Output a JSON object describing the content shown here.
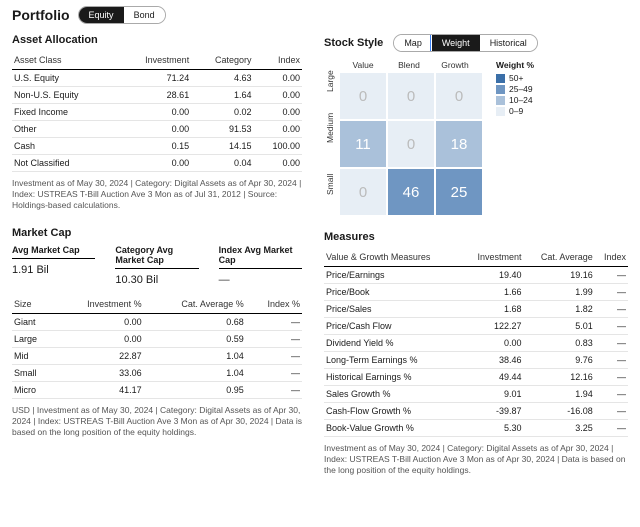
{
  "header": {
    "title": "Portfolio",
    "tabs": [
      "Equity",
      "Bond"
    ]
  },
  "asset_alloc": {
    "title": "Asset Allocation",
    "cols": [
      "Asset Class",
      "Investment",
      "Category",
      "Index"
    ],
    "rows": [
      {
        "c0": "U.S. Equity",
        "c1": "71.24",
        "c2": "4.63",
        "c3": "0.00"
      },
      {
        "c0": "Non-U.S. Equity",
        "c1": "28.61",
        "c2": "1.64",
        "c3": "0.00"
      },
      {
        "c0": "Fixed Income",
        "c1": "0.00",
        "c2": "0.02",
        "c3": "0.00"
      },
      {
        "c0": "Other",
        "c1": "0.00",
        "c2": "91.53",
        "c3": "0.00"
      },
      {
        "c0": "Cash",
        "c1": "0.15",
        "c2": "14.15",
        "c3": "100.00"
      },
      {
        "c0": "Not Classified",
        "c1": "0.00",
        "c2": "0.04",
        "c3": "0.00"
      }
    ],
    "foot": "Investment as of May 30, 2024 | Category: Digital Assets as of Apr 30, 2024 | Index: USTREAS T-Bill Auction Ave 3 Mon as of Jul 31, 2012 | Source: Holdings-based calculations."
  },
  "market_cap": {
    "title": "Market Cap",
    "avg_lbl": "Avg Market Cap",
    "avg_val": "1.91 Bil",
    "cat_lbl": "Category Avg Market Cap",
    "cat_val": "10.30 Bil",
    "idx_lbl": "Index Avg Market Cap",
    "idx_val": "—",
    "cols": [
      "Size",
      "Investment %",
      "Cat. Average %",
      "Index %"
    ],
    "rows": [
      {
        "c0": "Giant",
        "c1": "0.00",
        "c2": "0.68",
        "c3": "—"
      },
      {
        "c0": "Large",
        "c1": "0.00",
        "c2": "0.59",
        "c3": "—"
      },
      {
        "c0": "Mid",
        "c1": "22.87",
        "c2": "1.04",
        "c3": "—"
      },
      {
        "c0": "Small",
        "c1": "33.06",
        "c2": "1.04",
        "c3": "—"
      },
      {
        "c0": "Micro",
        "c1": "41.17",
        "c2": "0.95",
        "c3": "—"
      }
    ],
    "foot": "USD | Investment as of May 30, 2024 | Category: Digital Assets as of Apr 30, 2024 | Index: USTREAS T-Bill Auction Ave 3 Mon as of Apr 30, 2024 | Data is based on the long position of the equity holdings."
  },
  "style": {
    "title": "Stock Style",
    "tabs": [
      "Map",
      "Weight",
      "Historical"
    ],
    "col_lbls": [
      "Value",
      "Blend",
      "Growth"
    ],
    "row_lbls": [
      "Large",
      "Medium",
      "Small"
    ],
    "cells": [
      "0",
      "0",
      "0",
      "11",
      "0",
      "18",
      "0",
      "46",
      "25"
    ],
    "legend_title": "Weight %",
    "legend": [
      {
        "lbl": "50+",
        "cls": "w50"
      },
      {
        "lbl": "25–49",
        "cls": "w25"
      },
      {
        "lbl": "10–24",
        "cls": "w10"
      },
      {
        "lbl": "0–9",
        "cls": "w0"
      }
    ]
  },
  "measures": {
    "title": "Measures",
    "cols": [
      "Value & Growth Measures",
      "Investment",
      "Cat. Average",
      "Index"
    ],
    "rows": [
      {
        "c0": "Price/Earnings",
        "c1": "19.40",
        "c2": "19.16",
        "c3": "—"
      },
      {
        "c0": "Price/Book",
        "c1": "1.66",
        "c2": "1.99",
        "c3": "—"
      },
      {
        "c0": "Price/Sales",
        "c1": "1.68",
        "c2": "1.82",
        "c3": "—"
      },
      {
        "c0": "Price/Cash Flow",
        "c1": "122.27",
        "c2": "5.01",
        "c3": "—"
      },
      {
        "c0": "Dividend Yield %",
        "c1": "0.00",
        "c2": "0.83",
        "c3": "—"
      },
      {
        "c0": "Long-Term Earnings %",
        "c1": "38.46",
        "c2": "9.76",
        "c3": "—"
      },
      {
        "c0": "Historical Earnings %",
        "c1": "49.44",
        "c2": "12.16",
        "c3": "—"
      },
      {
        "c0": "Sales Growth %",
        "c1": "9.01",
        "c2": "1.94",
        "c3": "—"
      },
      {
        "c0": "Cash-Flow Growth %",
        "c1": "-39.87",
        "c2": "-16.08",
        "c3": "—"
      },
      {
        "c0": "Book-Value Growth %",
        "c1": "5.30",
        "c2": "3.25",
        "c3": "—"
      }
    ],
    "foot": "Investment as of May 30, 2024 | Category: Digital Assets as of Apr 30, 2024 | Index: USTREAS T-Bill Auction Ave 3 Mon as of Apr 30, 2024 | Data is based on the long position of the equity holdings."
  },
  "chart_data": {
    "type": "heatmap",
    "title": "Stock Style – Weight %",
    "x_categories": [
      "Value",
      "Blend",
      "Growth"
    ],
    "y_categories": [
      "Large",
      "Medium",
      "Small"
    ],
    "matrix": [
      [
        0,
        0,
        0
      ],
      [
        11,
        0,
        18
      ],
      [
        0,
        46,
        25
      ]
    ],
    "color_scale": [
      {
        "range": "50+",
        "color": "#3b6fa8"
      },
      {
        "range": "25–49",
        "color": "#6f96c2"
      },
      {
        "range": "10–24",
        "color": "#aac1da"
      },
      {
        "range": "0–9",
        "color": "#e7eef5"
      }
    ]
  }
}
